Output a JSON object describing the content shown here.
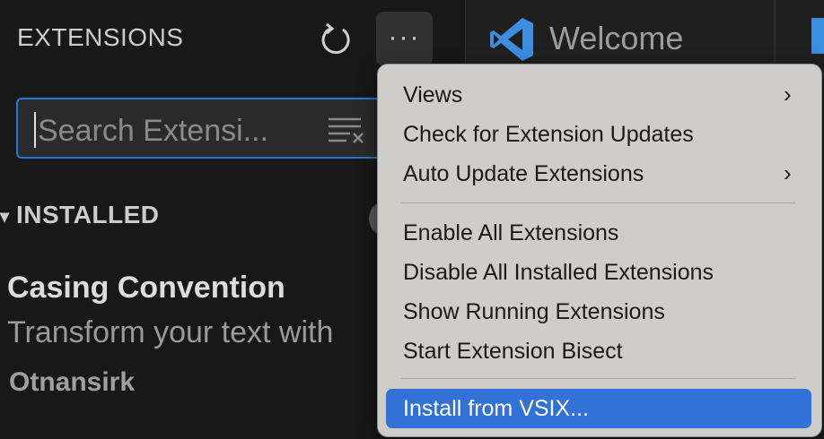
{
  "sidebar": {
    "title": "EXTENSIONS",
    "more_label": "···",
    "search": {
      "placeholder": "Search Extensi..."
    },
    "section": {
      "label": "INSTALLED"
    },
    "extension": {
      "name": "Casing Convention",
      "description": "Transform your text with",
      "publisher": "Otnansirk"
    }
  },
  "editor": {
    "tab_title": "Welcome"
  },
  "menu": {
    "items": [
      {
        "label": "Views",
        "submenu": true
      },
      {
        "label": "Check for Extension Updates",
        "submenu": false
      },
      {
        "label": "Auto Update Extensions",
        "submenu": true
      },
      {
        "label": "Enable All Extensions",
        "submenu": false
      },
      {
        "label": "Disable All Installed Extensions",
        "submenu": false
      },
      {
        "label": "Show Running Extensions",
        "submenu": false
      },
      {
        "label": "Start Extension Bisect",
        "submenu": false
      },
      {
        "label": "Install from VSIX...",
        "submenu": false,
        "highlighted": true
      }
    ],
    "submenu_arrow": "›"
  },
  "colors": {
    "accent": "#3272d6",
    "focus_border": "#1f7ad6",
    "vscode_blue": "#3c8ee0"
  }
}
